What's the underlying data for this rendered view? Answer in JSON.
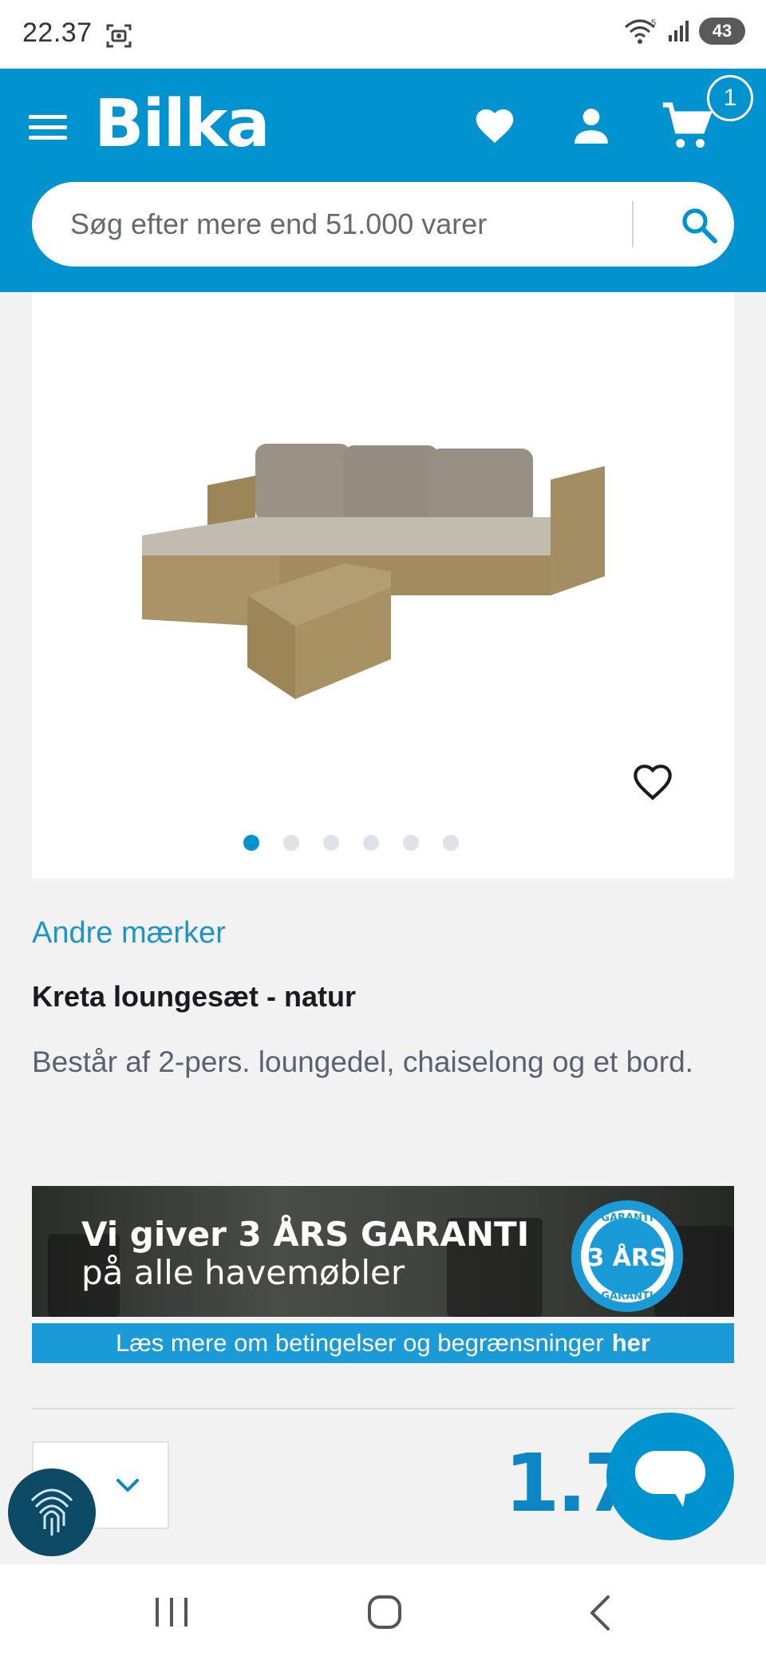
{
  "status_bar": {
    "time": "22.37",
    "network_label": "5",
    "battery": "43"
  },
  "header": {
    "logo": "Bilka",
    "cart_count": "1",
    "search": {
      "placeholder": "Søg efter mere end 51.000 varer"
    },
    "brand_color": "#0093d0"
  },
  "product": {
    "image_dots_total": 6,
    "image_dots_active": 1,
    "brand": "Andre mærker",
    "title": "Kreta loungesæt - natur",
    "description": "Består af 2-pers. loungedel, chaiselong og et bord.",
    "price_visible": "1.79"
  },
  "banner": {
    "headline": "Vi giver 3 ÅRS GARANTI",
    "subheadline": "på alle havemøbler",
    "seal_top": "GARANTI",
    "seal_center": "3 ÅRS",
    "seal_bottom": "GARANTI",
    "link_text": "Læs mere om betingelser og begrænsninger",
    "link_emphasis": "her"
  },
  "icons": {
    "menu": "menu-icon",
    "favorites": "heart-icon",
    "account": "user-icon",
    "cart": "cart-icon",
    "search": "search-icon",
    "product_favorite": "heart-outline-icon",
    "quantity": "chevron-down-icon",
    "fingerprint": "fingerprint-icon",
    "chat": "chat-icon"
  }
}
